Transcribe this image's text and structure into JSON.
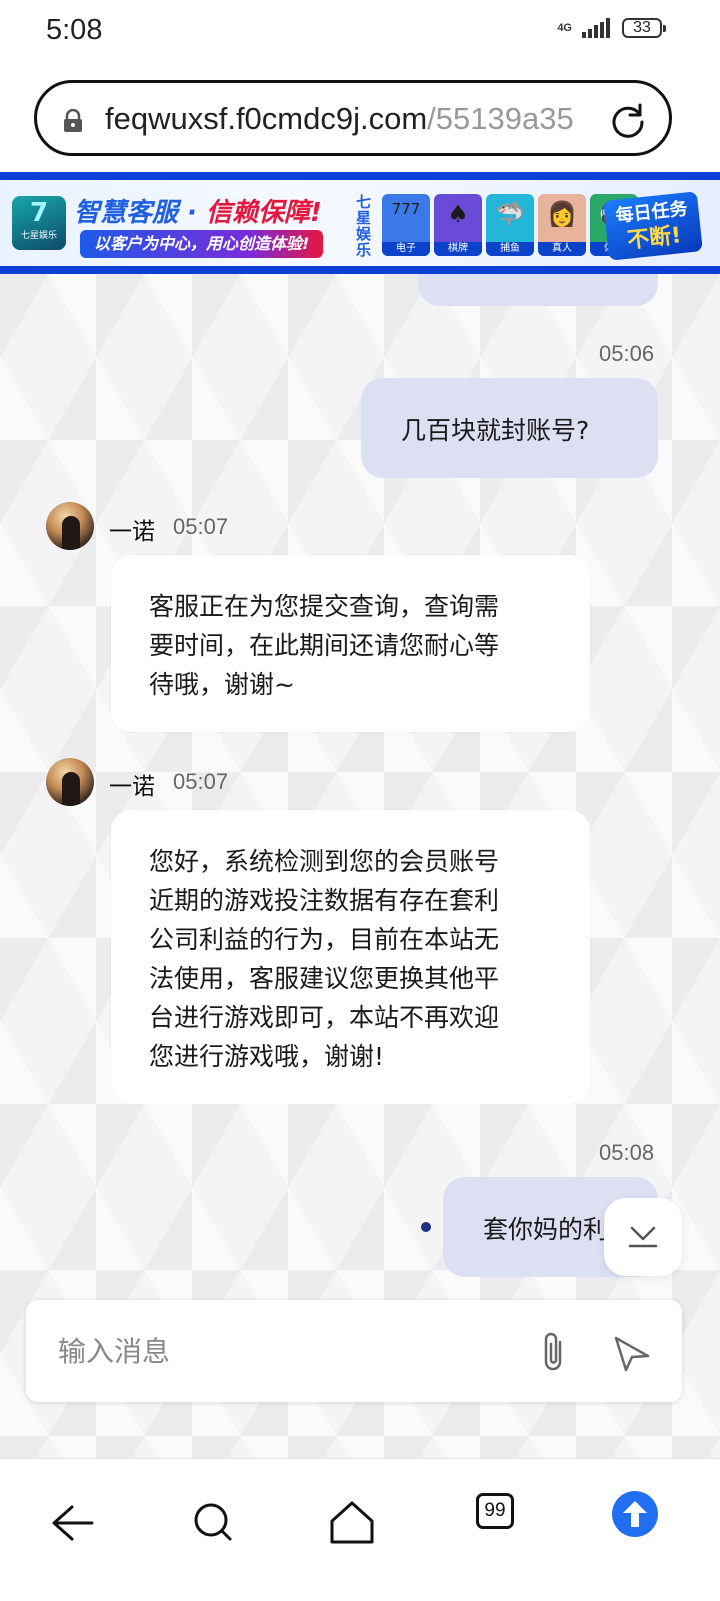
{
  "status_bar": {
    "time": "5:08",
    "network": "4G",
    "battery": "33"
  },
  "browser": {
    "url_host": "feqwuxsf.f0cmdc9j.com",
    "url_path": "/55139a35"
  },
  "banner": {
    "logo_symbol": "7",
    "logo_text": "七星娱乐",
    "title_blue": "智慧客服 · ",
    "title_red": "信赖保障!",
    "subtitle": "以客户为中心，用心创造体验!",
    "brand_vertical": "七星娱乐",
    "categories": [
      {
        "label": "电子",
        "color": "#3b79e8",
        "icon": "777"
      },
      {
        "label": "棋牌",
        "color": "#6a4bd8",
        "icon": "♠"
      },
      {
        "label": "捕鱼",
        "color": "#22b6d9",
        "icon": "🦈"
      },
      {
        "label": "真人",
        "color": "#e7b39a",
        "icon": "👩"
      },
      {
        "label": "体育",
        "color": "#2aa86a",
        "icon": "⚽"
      }
    ],
    "promo_line1": "每日任务",
    "promo_line2": "不断!"
  },
  "chat": {
    "messages": [
      {
        "type": "out",
        "time": "05:06",
        "text": "几百块就封账号?"
      },
      {
        "type": "in",
        "sender": "一诺",
        "time": "05:07",
        "lines": [
          "客服正在为您提交查询，查询需",
          "要时间，在此期间还请您耐心等",
          "待哦，谢谢~"
        ]
      },
      {
        "type": "in",
        "sender": "一诺",
        "time": "05:07",
        "lines": [
          "您好，系统检测到您的会员账号",
          "近期的游戏投注数据有存在套利",
          "公司利益的行为，目前在本站无",
          "法使用，客服建议您更换其他平",
          "台进行游戏即可，本站不再欢迎",
          "您进行游戏哦，谢谢!"
        ]
      },
      {
        "type": "out",
        "time": "05:08",
        "text": "套你妈的利"
      }
    ],
    "input_placeholder": "输入消息"
  },
  "icons": {
    "lock": "lock-icon",
    "reload": "reload-icon",
    "attach": "paperclip-icon",
    "send": "send-icon",
    "scroll": "scroll-down-icon",
    "back": "back-arrow-icon",
    "search": "search-icon",
    "home": "home-icon",
    "upload": "upload-arrow-icon"
  },
  "nav": {
    "tab_count": "99"
  },
  "colors": {
    "accent": "#1f6ff0",
    "outgoing_bubble": "#dde0f2",
    "banner_border": "#0b3fd6"
  }
}
